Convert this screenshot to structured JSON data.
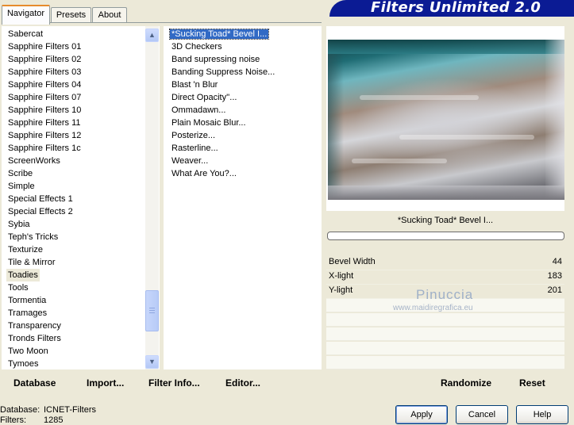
{
  "tabs": [
    {
      "label": "Navigator",
      "active": true
    },
    {
      "label": "Presets",
      "active": false
    },
    {
      "label": "About",
      "active": false
    }
  ],
  "app_title": "Filters Unlimited 2.0",
  "categories": [
    "Sabercat",
    "Sapphire Filters 01",
    "Sapphire Filters 02",
    "Sapphire Filters 03",
    "Sapphire Filters 04",
    "Sapphire Filters 07",
    "Sapphire Filters 10",
    "Sapphire Filters 11",
    "Sapphire Filters 12",
    "Sapphire Filters 1c",
    "ScreenWorks",
    "Scribe",
    "Simple",
    "Special Effects 1",
    "Special Effects 2",
    "Sybia",
    "Teph's Tricks",
    "Texturize",
    "Tile & Mirror",
    "Toadies",
    "Tools",
    "Tormentia",
    "Tramages",
    "Transparency",
    "Tronds Filters",
    "Two Moon",
    "Tymoes"
  ],
  "selected_category": "Toadies",
  "filters": [
    "*Sucking Toad*  Bevel I...",
    "3D Checkers",
    "Band supressing noise",
    "Banding Suppress Noise...",
    "Blast 'n Blur",
    "Direct Opacity''...",
    "Ommadawn...",
    "Plain Mosaic Blur...",
    "Posterize...",
    "Rasterline...",
    "Weaver...",
    "What Are You?..."
  ],
  "selected_filter": "*Sucking Toad*  Bevel I...",
  "preview_filter_title": "*Sucking Toad*  Bevel I...",
  "params": [
    {
      "label": "Bevel Width",
      "value": "44"
    },
    {
      "label": "X-light",
      "value": "183"
    },
    {
      "label": "Y-light",
      "value": "201"
    }
  ],
  "watermark": {
    "name": "Pinuccia",
    "url": "www.maidiregrafica.eu"
  },
  "left_buttons": {
    "database": "Database",
    "import": "Import...",
    "filter_info": "Filter Info...",
    "editor": "Editor..."
  },
  "right_buttons": {
    "randomize": "Randomize",
    "reset": "Reset"
  },
  "status": {
    "database_label": "Database:",
    "database_value": "ICNET-Filters",
    "filters_label": "Filters:",
    "filters_value": "1285"
  },
  "dialog_buttons": {
    "apply": "Apply",
    "cancel": "Cancel",
    "help": "Help"
  },
  "colors": {
    "banner": "#0b1b94",
    "selection": "#316ac5",
    "dialog_bg": "#ece9d8"
  }
}
